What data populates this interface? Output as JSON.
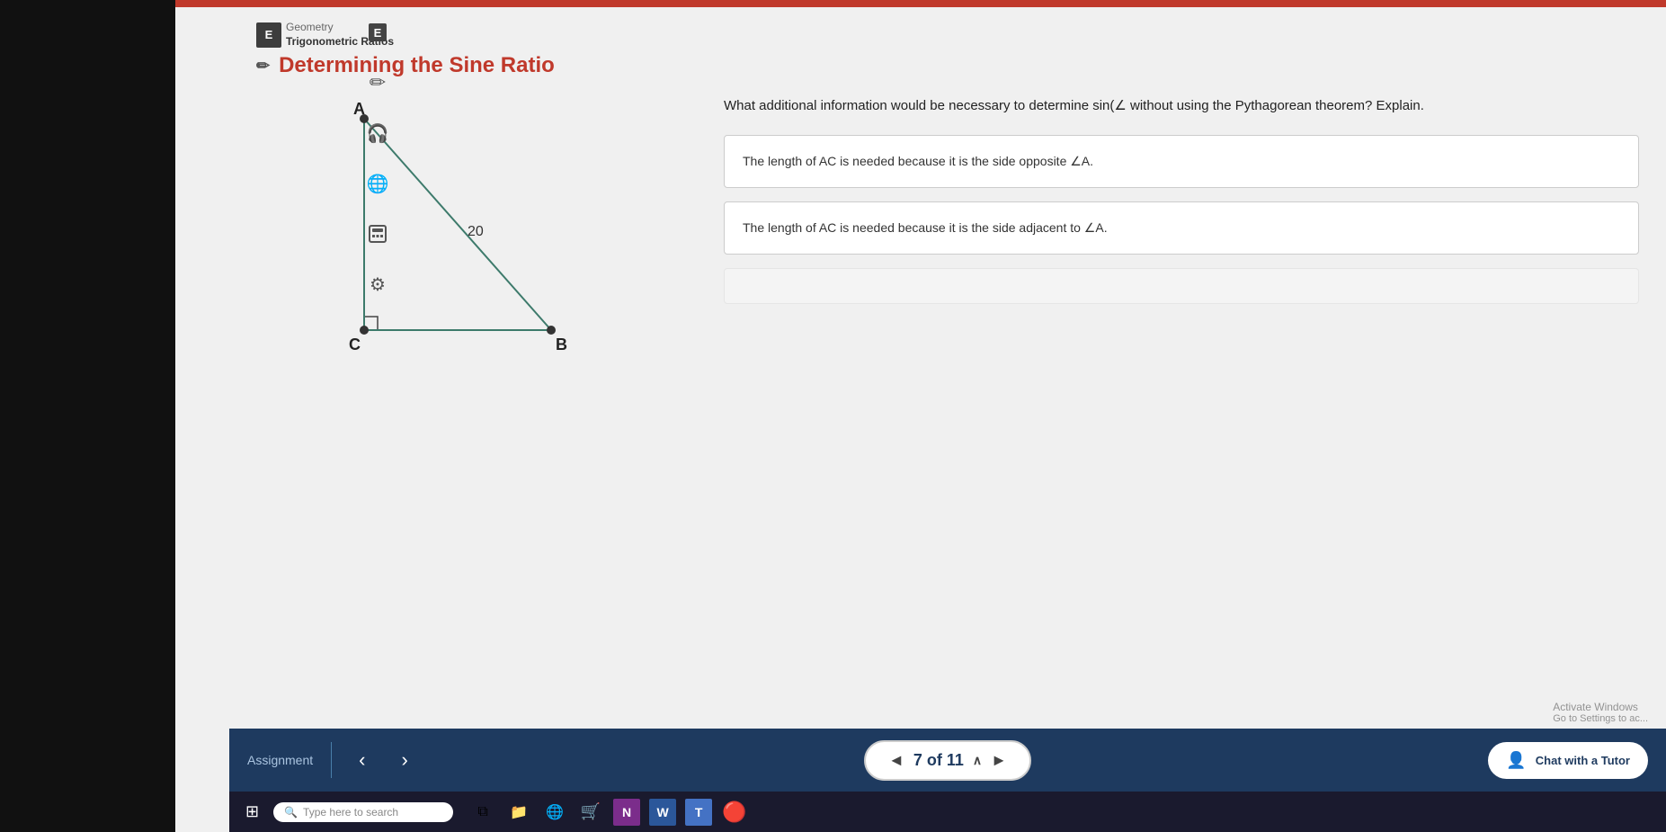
{
  "app": {
    "breadcrumb_subject": "Geometry",
    "breadcrumb_topic": "Trigonometric Ratios",
    "breadcrumb_icon": "E",
    "page_title": "Determining the Sine Ratio"
  },
  "question": {
    "text": "What additional information would be necessary to determine sin(∠ without using the Pythagorean theorem? Explain.",
    "triangle": {
      "label_a": "A",
      "label_b": "B",
      "label_c": "C",
      "hypotenuse_label": "20"
    },
    "answer_options": [
      {
        "id": 1,
        "text": "The length of AC is needed because it is the side opposite ∠A."
      },
      {
        "id": 2,
        "text": "The length of AC is needed because it is the side adjacent to ∠A."
      }
    ]
  },
  "navigation": {
    "assignment_label": "Assignment",
    "prev_label": "‹",
    "next_label": "›",
    "progress_text": "7 of 11",
    "progress_arrow_left": "◄",
    "progress_arrow_right": "▶",
    "chat_label": "Chat with a Tutor",
    "activate_windows_text": "Activate Windows",
    "activate_windows_sub": "Go to Settings to ac..."
  },
  "taskbar": {
    "search_placeholder": "Type here to search",
    "search_icon": "🔍",
    "win_start_icon": "⊞",
    "icons": [
      {
        "name": "task-view",
        "symbol": "⧉"
      },
      {
        "name": "file-explorer",
        "symbol": "📁"
      },
      {
        "name": "edge-browser",
        "symbol": "🌎"
      },
      {
        "name": "store",
        "symbol": "🛒"
      },
      {
        "name": "onenote",
        "symbol": "N"
      },
      {
        "name": "word",
        "symbol": "W"
      },
      {
        "name": "teams",
        "symbol": "T️"
      },
      {
        "name": "chrome",
        "symbol": "⬤"
      }
    ]
  },
  "sidebar": {
    "icons": [
      {
        "name": "book-icon",
        "symbol": "E",
        "active": true
      },
      {
        "name": "pencil-icon",
        "symbol": "✎",
        "active": false
      },
      {
        "name": "headphones-icon",
        "symbol": "🎧",
        "active": false
      },
      {
        "name": "globe-icon",
        "symbol": "🌐",
        "active": false
      },
      {
        "name": "calculator-icon",
        "symbol": "🖩",
        "active": false
      },
      {
        "name": "tools-icon",
        "symbol": "⚒",
        "active": false
      }
    ]
  }
}
